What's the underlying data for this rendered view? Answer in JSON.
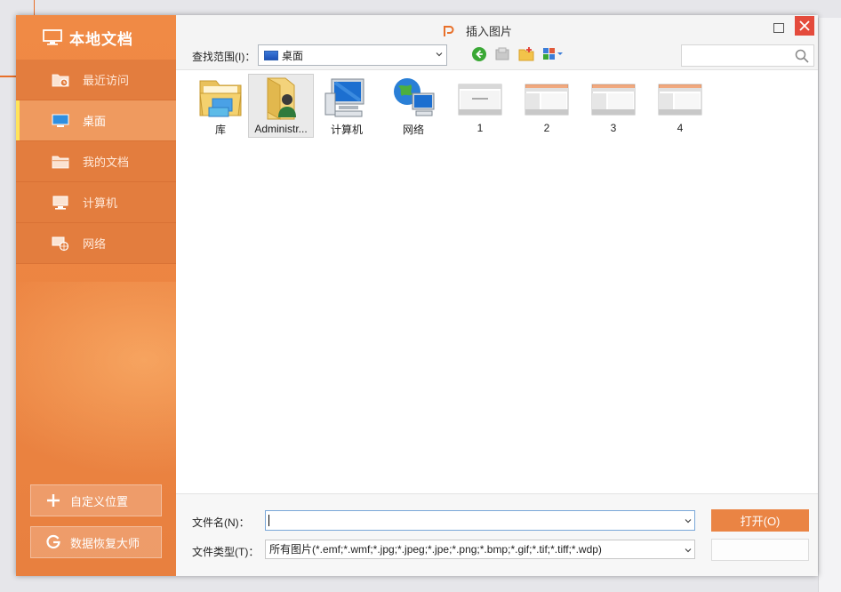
{
  "colors": {
    "accent": "#ea8444",
    "sidebar": "#ec8442",
    "close": "#e44b3c",
    "active_marker": "#ffe45a"
  },
  "sidebar": {
    "title": "本地文档",
    "items": [
      {
        "label": "最近访问",
        "icon": "recent-folder-icon"
      },
      {
        "label": "桌面",
        "icon": "desktop-icon",
        "active": true
      },
      {
        "label": "我的文档",
        "icon": "documents-folder-icon"
      },
      {
        "label": "计算机",
        "icon": "computer-icon"
      },
      {
        "label": "网络",
        "icon": "network-icon"
      }
    ],
    "custom_location": "自定义位置",
    "data_recovery": "数据恢复大师"
  },
  "window": {
    "title": "插入图片"
  },
  "toolbar": {
    "look_in_label": "查找范围(I)：",
    "look_in_value": "桌面",
    "search_placeholder": ""
  },
  "files": [
    {
      "label": "库",
      "icon": "library-icon"
    },
    {
      "label": "Administr...",
      "icon": "user-folder-icon",
      "selected": true
    },
    {
      "label": "计算机",
      "icon": "computer-icon"
    },
    {
      "label": "网络",
      "icon": "network-globe-icon"
    },
    {
      "label": "1",
      "icon": "slide-thumbnail-icon"
    },
    {
      "label": "2",
      "icon": "slide-thumbnail-icon"
    },
    {
      "label": "3",
      "icon": "slide-thumbnail-icon"
    },
    {
      "label": "4",
      "icon": "slide-thumbnail-icon"
    }
  ],
  "bottom": {
    "filename_label": "文件名(N)：",
    "filename_value": "",
    "filetype_label": "文件类型(T)：",
    "filetype_value": "所有图片(*.emf;*.wmf;*.jpg;*.jpeg;*.jpe;*.png;*.bmp;*.gif;*.tif;*.tiff;*.wdp)",
    "open_label": "打开(O)"
  }
}
